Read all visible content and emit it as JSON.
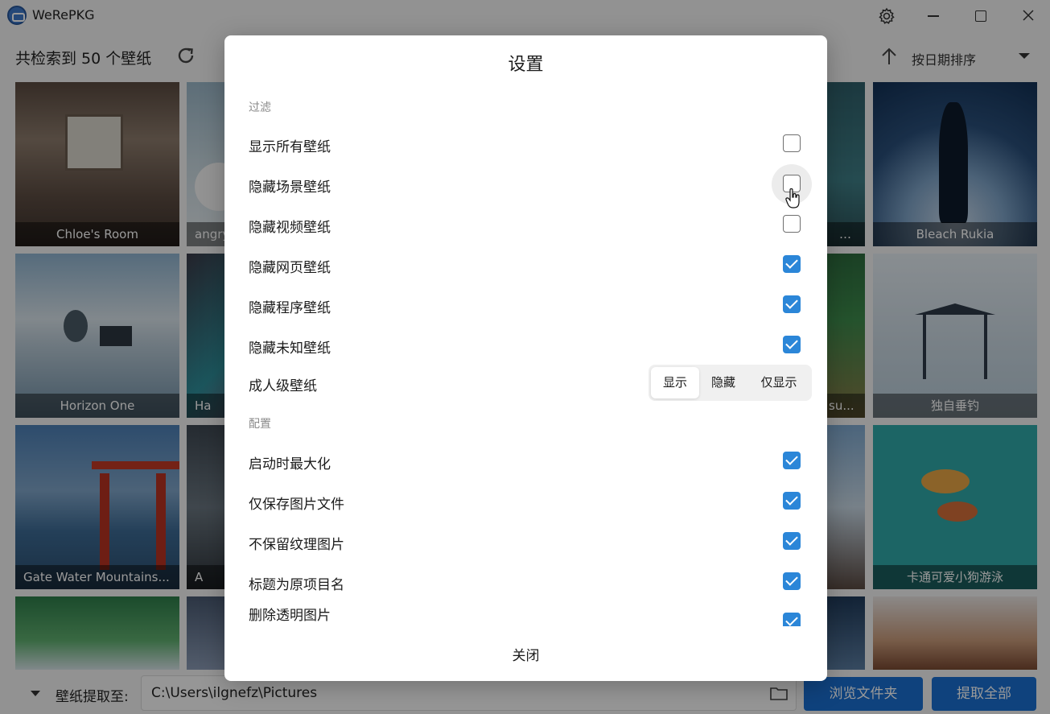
{
  "app": {
    "title": "WeRePKG"
  },
  "header": {
    "count_text": "共检索到 50 个壁纸",
    "sort_label": "按日期排序"
  },
  "wallpapers": {
    "c0r0": "Chloe's Room",
    "c1r0": "angry",
    "c4r0": "…",
    "c5r0": "Bleach Rukia",
    "c0r1": "Horizon One",
    "c1r1": "Ha",
    "c4r1": "su...",
    "c5r1": "独自垂钓",
    "c0r2": "Gate Water Mountains...",
    "c1r2": "A",
    "c5r2": "卡通可爱小狗游泳"
  },
  "bottom": {
    "extract_label": "壁纸提取至:",
    "path": "C:\\Users\\ilgnefz\\Pictures",
    "browse_label": "浏览文件夹",
    "extract_all_label": "提取全部"
  },
  "dialog": {
    "title": "设置",
    "filter_section": "过滤",
    "filter_items": [
      {
        "label": "显示所有壁纸",
        "checked": false
      },
      {
        "label": "隐藏场景壁纸",
        "checked": false
      },
      {
        "label": "隐藏视频壁纸",
        "checked": false
      },
      {
        "label": "隐藏网页壁纸",
        "checked": true
      },
      {
        "label": "隐藏程序壁纸",
        "checked": true
      },
      {
        "label": "隐藏未知壁纸",
        "checked": true
      }
    ],
    "adult_label": "成人级壁纸",
    "adult_options": [
      "显示",
      "隐藏",
      "仅显示"
    ],
    "adult_selected": "显示",
    "config_section": "配置",
    "config_items": [
      {
        "label": "启动时最大化",
        "checked": true
      },
      {
        "label": "仅保存图片文件",
        "checked": true
      },
      {
        "label": "不保留纹理图片",
        "checked": true
      },
      {
        "label": "标题为原项目名",
        "checked": true
      },
      {
        "label": "删除透明图片",
        "checked": true
      }
    ],
    "close_label": "关闭"
  },
  "colors": {
    "accent": "#2b86d8",
    "primary_button": "#1a6fd1",
    "overlay": "rgba(0,0,0,0.40)"
  }
}
